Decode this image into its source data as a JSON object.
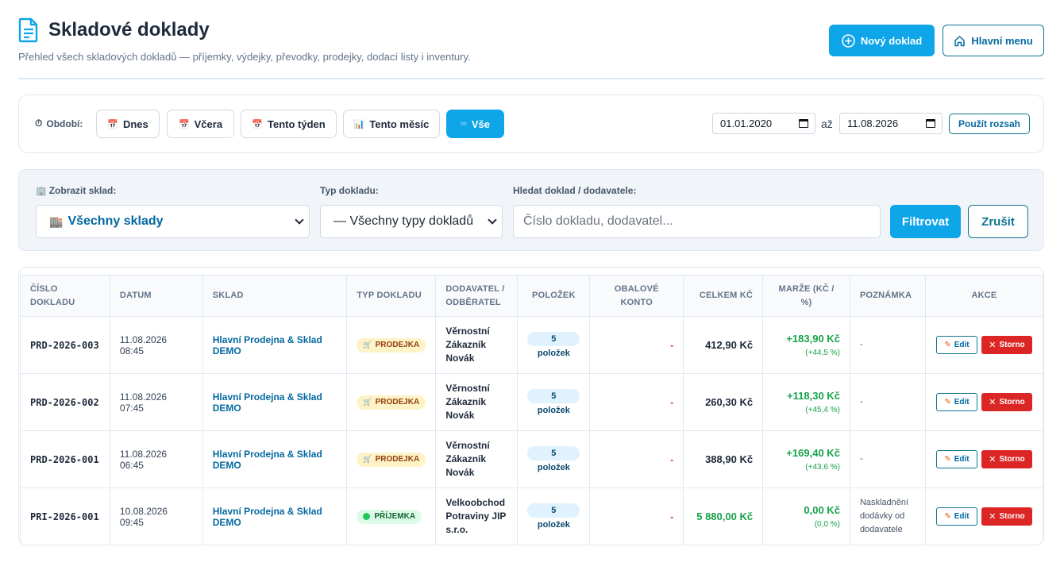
{
  "header": {
    "title": "Skladové doklady",
    "subtitle": "Přehled všech skladových dokladů — příjemky, výdejky, převodky, prodejky, dodací listy i inventury.",
    "new_button": "Nový doklad",
    "menu_button": "Hlavní menu"
  },
  "period": {
    "label": "Období:",
    "buttons": [
      "Dnes",
      "Včera",
      "Tento týden",
      "Tento měsíc",
      "Vše"
    ],
    "active": "Vše",
    "date_from": "01.01.2020",
    "date_to": "11.08.2026",
    "to_label": "až",
    "apply_button": "Použít rozsah"
  },
  "filters": {
    "sklad_label": "Zobrazit sklad:",
    "sklad_value": "Všechny sklady",
    "typ_label": "Typ dokladu:",
    "typ_value": "— Všechny typy dokladů —",
    "search_label": "Hledat doklad / dodavatele:",
    "search_placeholder": "Číslo dokladu, dodavatel...",
    "filter_button": "Filtrovat",
    "cancel_button": "Zrušit"
  },
  "table": {
    "columns": [
      "Číslo dokladu",
      "Datum",
      "Sklad",
      "Typ dokladu",
      "Dodavatel / odběratel",
      "Položek",
      "Obalové konto",
      "Celkem Kč",
      "Marže (Kč / %)",
      "Poznámka",
      "Akce"
    ],
    "edit_label": "Edit",
    "storno_label": "Storno",
    "rows": [
      {
        "doc": "PRD-2026-003",
        "date": "11.08.2026 08:45",
        "sklad": "Hlavní Prodejna & Sklad DEMO",
        "type": "PRODEJKA",
        "kind": "prod",
        "partner": "Věrnostní Zákazník Novák",
        "items": "5 položek",
        "obal": "-",
        "total": "412,90 Kč",
        "marze": "+183,90 Kč",
        "marze_pct": "(+44,5 %)",
        "note": "-"
      },
      {
        "doc": "PRD-2026-002",
        "date": "11.08.2026 07:45",
        "sklad": "Hlavní Prodejna & Sklad DEMO",
        "type": "PRODEJKA",
        "kind": "prod",
        "partner": "Věrnostní Zákazník Novák",
        "items": "5 položek",
        "obal": "-",
        "total": "260,30 Kč",
        "marze": "+118,30 Kč",
        "marze_pct": "(+45,4 %)",
        "note": "-"
      },
      {
        "doc": "PRD-2026-001",
        "date": "11.08.2026 06:45",
        "sklad": "Hlavní Prodejna & Sklad DEMO",
        "type": "PRODEJKA",
        "kind": "prod",
        "partner": "Věrnostní Zákazník Novák",
        "items": "5 položek",
        "obal": "-",
        "total": "388,90 Kč",
        "marze": "+169,40 Kč",
        "marze_pct": "(+43,6 %)",
        "note": "-"
      },
      {
        "doc": "PRI-2026-001",
        "date": "10.08.2026 09:45",
        "sklad": "Hlavní Prodejna & Sklad DEMO",
        "type": "PŘÍJEMKA",
        "kind": "prij",
        "partner": "Velkoobchod Potraviny JIP s.r.o.",
        "items": "5 položek",
        "obal": "-",
        "total": "5 880,00 Kč",
        "marze": "0,00 Kč",
        "marze_pct": "(0,0 %)",
        "note": "Naskladnění dodávky od dodavatele"
      }
    ]
  },
  "colors": {
    "accent": "#0ea5e9",
    "link": "#0369a1",
    "danger": "#dc2626",
    "success": "#16a34a"
  }
}
